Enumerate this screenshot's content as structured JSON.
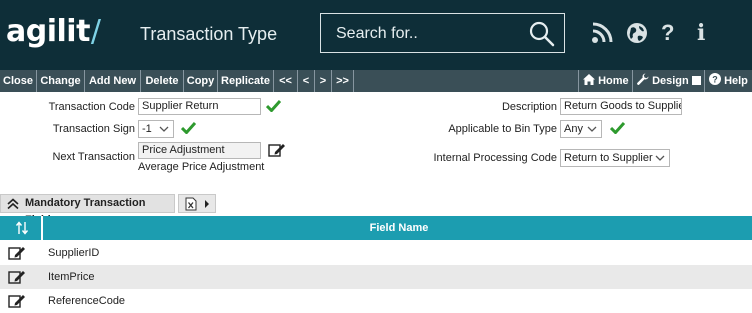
{
  "app": {
    "logo": "agilit",
    "title": "Transaction Type"
  },
  "search": {
    "placeholder": "Search for.."
  },
  "header_icons": [
    "rss-icon",
    "globe-icon",
    "help-icon",
    "info-icon"
  ],
  "toolbar": {
    "left": [
      "Close",
      "Change",
      "Add New",
      "Delete",
      "Copy",
      "Replicate",
      "<<",
      "<",
      ">",
      ">>"
    ],
    "home": "Home",
    "design": "Design",
    "help": "Help"
  },
  "form": {
    "transaction_code": {
      "label": "Transaction Code",
      "value": "Supplier Return"
    },
    "transaction_sign": {
      "label": "Transaction Sign",
      "value": "-1"
    },
    "next_transaction": {
      "label": "Next Transaction",
      "value": "Price Adjustment",
      "description": "Average Price Adjustment"
    },
    "description": {
      "label": "Description",
      "value": "Return Goods to Supplier"
    },
    "bin_type": {
      "label": "Applicable to Bin Type",
      "value": "Any"
    },
    "internal_code": {
      "label": "Internal Processing Code",
      "value": "Return to Supplier"
    }
  },
  "section": {
    "title": "Mandatory Transaction Fields"
  },
  "table": {
    "column": "Field Name",
    "rows": [
      "SupplierID",
      "ItemPrice",
      "ReferenceCode"
    ]
  },
  "colors": {
    "header": "#0e2e38",
    "toolbar": "#3a4f57",
    "accent": "#1c9db0",
    "check": "#2e9a2e"
  }
}
